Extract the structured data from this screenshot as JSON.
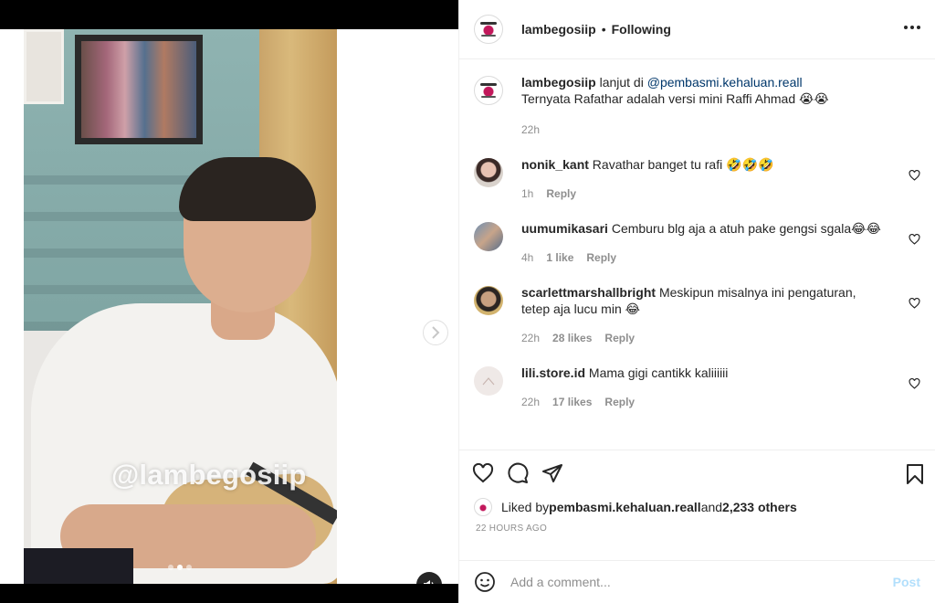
{
  "post": {
    "author": "lambegosiip",
    "separator": "•",
    "follow_status": "Following",
    "watermark": "@lambegosiip",
    "carousel_count": 3,
    "carousel_active_index": 1
  },
  "caption": {
    "username": "lambegosiip",
    "text_prefix": " lanjut di ",
    "mention": "@pembasmi.kehaluan.reall",
    "line2": "Ternyata Rafathar adalah versi mini Raffi Ahmad 😭😭",
    "time": "22h"
  },
  "comments": [
    {
      "username": "nonik_kant",
      "text": " Ravathar banget tu rafi 🤣🤣🤣",
      "time": "1h",
      "likes": "",
      "reply": "Reply"
    },
    {
      "username": "uumumikasari",
      "text": " Cemburu blg aja a atuh pake gengsi sgala😂😂",
      "time": "4h",
      "likes": "1 like",
      "reply": "Reply"
    },
    {
      "username": "scarlettmarshallbright",
      "text": " Meskipun misalnya ini pengaturan, tetep aja lucu min 😂",
      "time": "22h",
      "likes": "28 likes",
      "reply": "Reply"
    },
    {
      "username": "lili.store.id",
      "text": " Mama gigi cantikk kaliiiiii",
      "time": "22h",
      "likes": "17 likes",
      "reply": "Reply"
    }
  ],
  "likes": {
    "prefix": "Liked by ",
    "liker": "pembasmi.kehaluan.reall",
    "middle": " and ",
    "others": "2,233 others"
  },
  "timestamp": "22 HOURS AGO",
  "add_comment": {
    "placeholder": "Add a comment...",
    "post_label": "Post"
  },
  "colors": {
    "link": "#00376b",
    "muted": "#8e8e8e",
    "post_disabled": "#b2dffc"
  }
}
